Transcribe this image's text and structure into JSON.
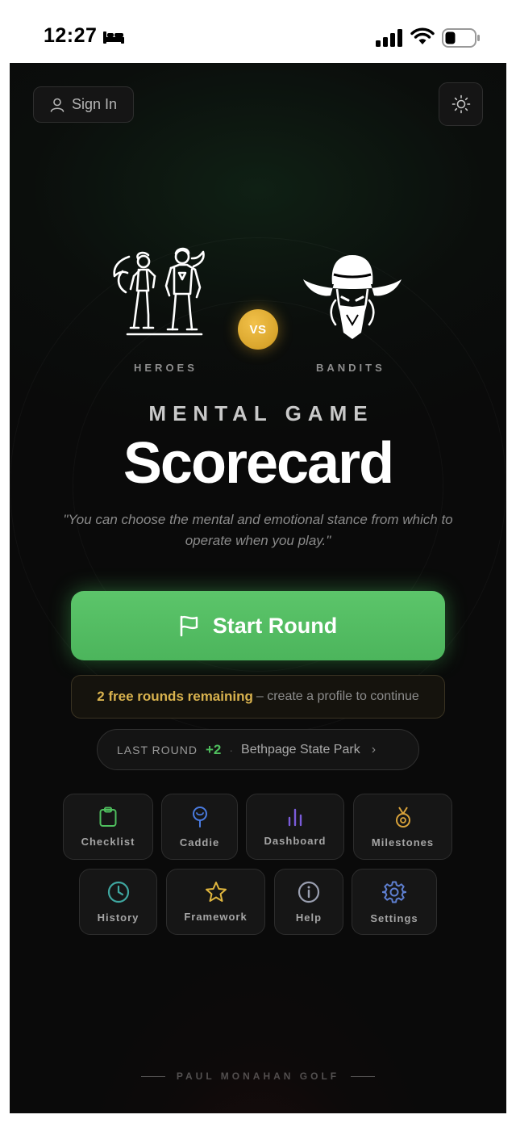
{
  "status_bar": {
    "time": "12:27",
    "icons": [
      "bed-icon",
      "cellular-signal-icon",
      "wifi-icon",
      "battery-icon"
    ]
  },
  "header": {
    "sign_in_label": "Sign In",
    "sign_in_icon": "user-icon",
    "theme_toggle_icon": "sun-icon"
  },
  "hero": {
    "left_team": "HEROES",
    "vs": "VS",
    "right_team": "BANDITS",
    "kicker": "MENTAL GAME",
    "title": "Scorecard",
    "quote": "\"You can choose the mental and emotional stance from which to operate when you play.\""
  },
  "start_round": {
    "label": "Start Round",
    "icon": "flag-icon"
  },
  "free_rounds": {
    "highlight": "2 free rounds remaining",
    "rest": "– create a profile to continue"
  },
  "last_round": {
    "label": "LAST ROUND",
    "score": "+2",
    "separator": "·",
    "course": "Bethpage State Park",
    "chevron": "›"
  },
  "nav_tiles": [
    {
      "label": "Checklist",
      "icon": "clipboard-icon",
      "color": "#4fbf5e"
    },
    {
      "label": "Caddie",
      "icon": "caddie-pin-icon",
      "color": "#4a7be0"
    },
    {
      "label": "Dashboard",
      "icon": "bar-chart-icon",
      "color": "#7a5bd9"
    },
    {
      "label": "Milestones",
      "icon": "medal-icon",
      "color": "#d8a23a"
    },
    {
      "label": "History",
      "icon": "clock-icon",
      "color": "#3fa7a0"
    },
    {
      "label": "Framework",
      "icon": "star-icon",
      "color": "#e0b63e"
    },
    {
      "label": "Help",
      "icon": "info-icon",
      "color": "#9a9fb0"
    },
    {
      "label": "Settings",
      "icon": "gear-icon",
      "color": "#5e7fd0"
    }
  ],
  "footer": {
    "brand": "PAUL MONAHAN GOLF"
  },
  "colors": {
    "accent_green": "#55bd65",
    "gold": "#d8b24e",
    "background": "#0a0a0a"
  }
}
